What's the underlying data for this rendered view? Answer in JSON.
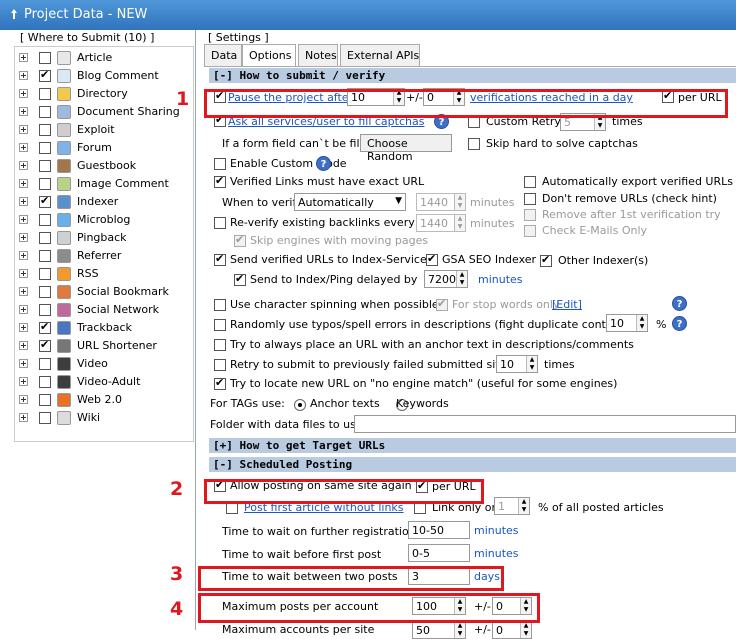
{
  "window": {
    "title": "Project Data - NEW"
  },
  "left": {
    "header": "[ Where to Submit  (10) ]",
    "items": [
      {
        "label": "Article",
        "checked": false,
        "icon": "article-icon",
        "color": "#e8e8e8"
      },
      {
        "label": "Blog Comment",
        "checked": true,
        "icon": "comment-icon",
        "color": "#d7e9f7"
      },
      {
        "label": "Directory",
        "checked": false,
        "icon": "directory-icon",
        "color": "#f2c94c"
      },
      {
        "label": "Document Sharing",
        "checked": false,
        "icon": "document-icon",
        "color": "#9db9de"
      },
      {
        "label": "Exploit",
        "checked": false,
        "icon": "exploit-icon",
        "color": "#cfcfcf"
      },
      {
        "label": "Forum",
        "checked": false,
        "icon": "forum-icon",
        "color": "#7fb3e6"
      },
      {
        "label": "Guestbook",
        "checked": false,
        "icon": "guestbook-icon",
        "color": "#a0784a"
      },
      {
        "label": "Image Comment",
        "checked": false,
        "icon": "image-icon",
        "color": "#b7d38a"
      },
      {
        "label": "Indexer",
        "checked": true,
        "icon": "indexer-icon",
        "color": "#5a8fd0"
      },
      {
        "label": "Microblog",
        "checked": false,
        "icon": "microblog-icon",
        "color": "#6ab0e8"
      },
      {
        "label": "Pingback",
        "checked": false,
        "icon": "pingback-icon",
        "color": "#d0d0d0"
      },
      {
        "label": "Referrer",
        "checked": false,
        "icon": "referrer-icon",
        "color": "#8c8c8c"
      },
      {
        "label": "RSS",
        "checked": false,
        "icon": "rss-icon",
        "color": "#f39a2e"
      },
      {
        "label": "Social Bookmark",
        "checked": false,
        "icon": "bookmark-icon",
        "color": "#e07a3a"
      },
      {
        "label": "Social Network",
        "checked": false,
        "icon": "network-icon",
        "color": "#c06a9a"
      },
      {
        "label": "Trackback",
        "checked": true,
        "icon": "trackback-icon",
        "color": "#4a78c0"
      },
      {
        "label": "URL Shortener",
        "checked": true,
        "icon": "shortener-icon",
        "color": "#777777"
      },
      {
        "label": "Video",
        "checked": false,
        "icon": "video-icon",
        "color": "#3d3d3d"
      },
      {
        "label": "Video-Adult",
        "checked": false,
        "icon": "video-adult-icon",
        "color": "#3d3d3d"
      },
      {
        "label": "Web 2.0",
        "checked": false,
        "icon": "web20-icon",
        "color": "#e8702a"
      },
      {
        "label": "Wiki",
        "checked": false,
        "icon": "wiki-icon",
        "color": "#dcdcdc"
      }
    ]
  },
  "right": {
    "header": "[ Settings ]",
    "tabs": [
      "Data",
      "Options",
      "Notes",
      "External APIs"
    ],
    "active_tab": "Options",
    "sec_submit": "[-] How to submit / verify",
    "pause_label": "Pause the project after",
    "pause_value": "10",
    "pause_pm": "+/-",
    "pause_var": "0",
    "pause_suffix": "verifications reached in a day",
    "per_url": "per URL",
    "captcha_label": "Ask all services/user to fill captchas",
    "custom_retry": "Custom Retry",
    "custom_retry_value": "5",
    "times": "times",
    "form_field_label": "If a form field can`t be filled",
    "choose_random": "Choose Random",
    "skip_hard": "Skip hard to solve captchas",
    "enable_custom_mode": "Enable Custom Mode",
    "verified_exact": "Verified Links must have exact URL",
    "auto_export": "Automatically export verified URLs",
    "when_verify": "When to verify",
    "when_verify_value": "Automatically",
    "when_verify_minutes_value": "1440",
    "minutes": "minutes",
    "dont_remove": "Don't remove URLs (check hint)",
    "remove_after": "Remove after 1st verification try",
    "reverify": "Re-verify existing backlinks every",
    "reverify_value": "1440",
    "check_email": "Check E-Mails Only",
    "skip_engines": "Skip engines with moving pages",
    "send_verified": "Send verified URLs to Index-Services",
    "gsa_seo": "GSA SEO Indexer",
    "other_indexer": "Other Indexer(s)",
    "send_ping": "Send to Index/Ping delayed by",
    "send_ping_value": "7200",
    "char_spin": "Use character spinning when possible",
    "stop_words": "For stop words only",
    "edit": "[Edit]",
    "random_typos": "Randomly use typos/spell errors in descriptions (fight duplicate content)",
    "typos_value": "10",
    "percent": "%",
    "anchor_place": "Try to always place an URL with an anchor text in descriptions/comments",
    "retry_failed": "Retry to submit to previously failed submitted sites",
    "retry_value": "10",
    "locate_new": "Try to locate new URL on \"no engine match\" (useful for some engines)",
    "for_tags": "For TAGs use:",
    "anchor_texts": "Anchor texts",
    "keywords": "Keywords",
    "folder_label": "Folder with data files to use",
    "sec_target": "[+] How to get Target URLs",
    "sec_sched": "[-] Scheduled Posting",
    "allow_same_site": "Allow posting on same site again",
    "per_url2": "per URL",
    "post_first": "Post first article without links",
    "link_only_on": "Link only on",
    "link_only_value": "1",
    "link_only_suffix": "% of all posted articles",
    "wait_reg": "Time to wait on further registrations",
    "wait_reg_value": "10-50",
    "wait_first": "Time to wait before first post",
    "wait_first_value": "0-5",
    "wait_between": "Time to wait between two posts",
    "wait_between_value": "3",
    "days": "days",
    "max_posts": "Maximum posts per account",
    "max_posts_value": "100",
    "max_posts_pm": "+/-",
    "max_posts_var": "0",
    "max_accounts": "Maximum accounts per site",
    "max_accounts_value": "50",
    "max_accounts_pm": "+/-",
    "max_accounts_var": "0"
  },
  "annotations": {
    "n1": "1",
    "n2": "2",
    "n3": "3",
    "n4": "4",
    "color": "#e0171f"
  }
}
